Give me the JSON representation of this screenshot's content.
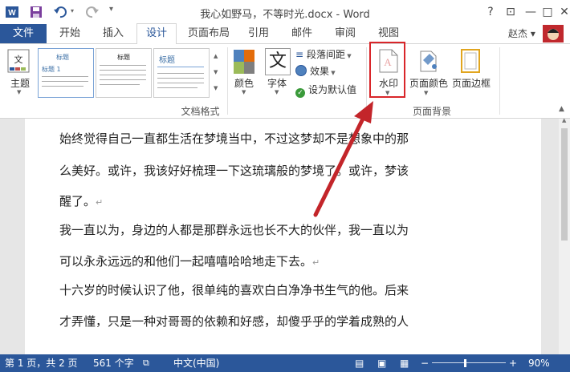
{
  "window": {
    "title": "我心如野马，不等时光.docx - Word",
    "controls": {
      "help": "?",
      "ribbon_options": "⊡",
      "minimize": "—",
      "restore": "□",
      "close": "✕"
    }
  },
  "quick_access": {
    "icons": [
      "word-app-icon",
      "save-icon",
      "undo-icon",
      "redo-icon",
      "customize-icon"
    ]
  },
  "tabs": {
    "file": "文件",
    "items": [
      {
        "label": "开始"
      },
      {
        "label": "插入"
      },
      {
        "label": "设计",
        "active": true
      },
      {
        "label": "页面布局"
      },
      {
        "label": "引用"
      },
      {
        "label": "邮件"
      },
      {
        "label": "审阅"
      },
      {
        "label": "视图"
      }
    ]
  },
  "user": {
    "name": "赵杰",
    "dropdown": "▾"
  },
  "ribbon": {
    "theme_label": "主题",
    "gallery": {
      "item1_title": "标题",
      "item1_heading": "标题 1",
      "item2_title": "标题",
      "item3_title": "标题"
    },
    "colors_label": "颜色",
    "fonts_label": "字体",
    "fonts_glyph": "文",
    "paragraph_spacing": "段落间距",
    "effects": "效果",
    "set_default": "设为默认值",
    "watermark": "水印",
    "page_color": "页面颜色",
    "page_borders": "页面边框",
    "group_document_format": "文档格式",
    "group_page_background": "页面背景"
  },
  "document": {
    "lines": [
      "始终觉得自己一直都生活在梦境当中，不过这梦却不是想象中的那",
      "么美好。或许，我该好好梳理一下这琉璃般的梦境了。或许，梦该",
      "醒了。",
      "我一直以为，身边的人都是那群永远也长不大的伙伴，我一直以为",
      "可以永永远远的和他们一起嘻嘻哈哈地走下去。",
      "十六岁的时候认识了他，很单纯的喜欢白白净净书生气的他。后来",
      "才弄懂，只是一种对哥哥的依赖和好感，却傻乎乎的学着成熟的人"
    ],
    "paragraph_mark": "↵"
  },
  "status_bar": {
    "page": "第 1 页，共 2 页",
    "words": "561 个字",
    "language": "中文(中国)",
    "zoom": "90%",
    "zoom_fraction": 0.9
  },
  "colors": {
    "accent": "#2b579a",
    "annotation": "#d9262a"
  }
}
